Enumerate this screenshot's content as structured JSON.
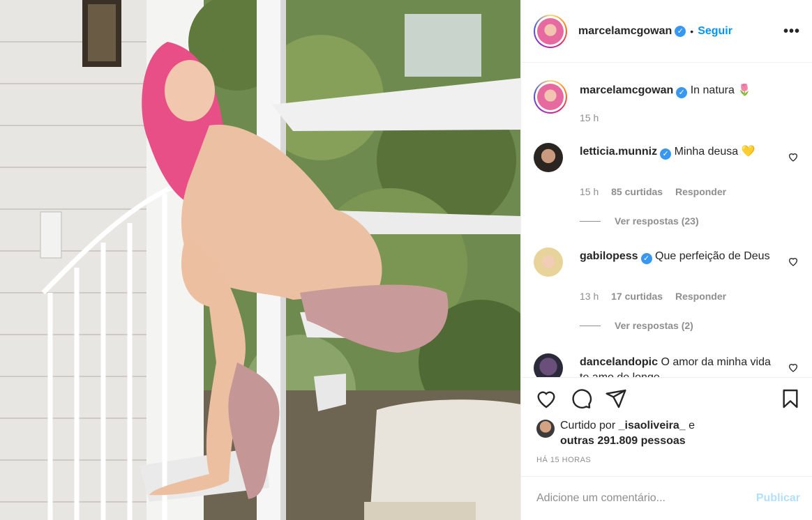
{
  "post": {
    "image_alt": "",
    "colors": {
      "accent": "#0095f6",
      "verified": "#3897f0",
      "muted": "#8e8e8e",
      "text": "#262626"
    }
  },
  "header": {
    "username": "marcelamcgowan",
    "dot": "•",
    "follow_label": "Seguir",
    "more_label": "•••"
  },
  "caption": {
    "username": "marcelamcgowan",
    "text": "In natura 🌷",
    "time": "15 h"
  },
  "comments": [
    {
      "username": "letticia.munniz",
      "text": "Minha deusa 💛",
      "time": "15 h",
      "likes": "85 curtidas",
      "reply_label": "Responder",
      "view_replies": "Ver respostas (23)"
    },
    {
      "username": "gabilopess",
      "text": "Que perfeição de Deus",
      "time": "13 h",
      "likes": "17 curtidas",
      "reply_label": "Responder",
      "view_replies": "Ver respostas (2)"
    },
    {
      "username": "dancelandopic",
      "text": "O amor da minha vida te amo de longe"
    }
  ],
  "likes": {
    "prefix": "Curtido por",
    "liker": "_isaoliveira_",
    "connector": "e",
    "others": "outras 291.809 pessoas"
  },
  "timestamp": "HÁ 15 HORAS",
  "comment_box": {
    "placeholder": "Adicione um comentário...",
    "publish_label": "Publicar"
  },
  "icons": {
    "verified": "✓",
    "heart": "heart-icon",
    "comment": "comment-icon",
    "share": "share-icon",
    "save": "bookmark-icon"
  }
}
